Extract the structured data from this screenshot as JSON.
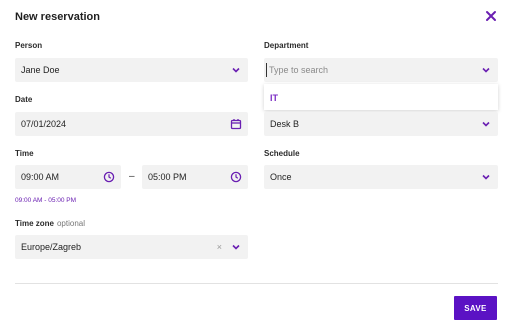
{
  "dialog": {
    "title": "New reservation",
    "close_icon": "close-icon"
  },
  "person": {
    "label": "Person",
    "value": "Jane Doe"
  },
  "department": {
    "label": "Department",
    "placeholder": "Type to search",
    "options": [
      "IT"
    ]
  },
  "date": {
    "label": "Date",
    "value": "07/01/2024"
  },
  "desk": {
    "value": "Desk B"
  },
  "time": {
    "label": "Time",
    "start": "09:00 AM",
    "separator": "–",
    "end": "05:00 PM",
    "hint": "09:00 AM - 05:00 PM"
  },
  "schedule": {
    "label": "Schedule",
    "value": "Once"
  },
  "timezone": {
    "label": "Time zone",
    "optional": "optional",
    "value": "Europe/Zagreb",
    "clear": "×"
  },
  "actions": {
    "save_label": "SAVE"
  },
  "colors": {
    "accent": "#5b12c4",
    "accent_text": "#7b2dc4",
    "field_bg": "#f2f2f2"
  }
}
